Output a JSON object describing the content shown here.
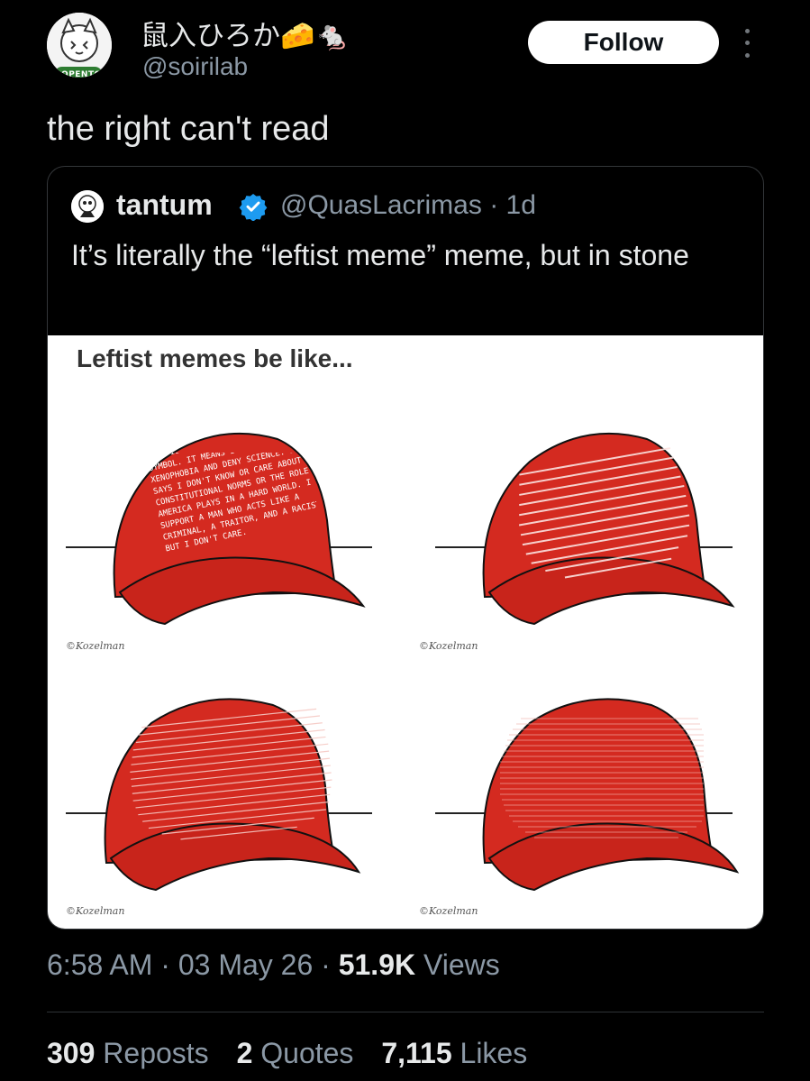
{
  "author": {
    "display_name": "鼠入ひろか🧀🐁",
    "handle": "@soirilab",
    "avatar_badge": "#OPENTOWORK"
  },
  "follow_label": "Follow",
  "tweet_text": "the right can't read",
  "quoted": {
    "name": "tantum",
    "handle_time": "@QuasLacrimas · 1d",
    "text": "It’s literally the “leftist meme” meme, but in stone",
    "meme": {
      "title": "Leftist memes be like...",
      "panel1_text": "THIS ISN'T JUST A HAT. IT'S A SYMBOL. IT MEANS I SUPPORT XENOPHOBIA AND DENY SCIENCE. IT SAYS I DON'T KNOW OR CARE ABOUT CONSTITUTIONAL NORMS OR THE ROLE AMERICA PLAYS IN A HARD WORLD. I SUPPORT A MAN WHO ACTS LIKE A CRIMINAL, A TRAITOR, AND A RACIST. BUT I DON'T CARE.",
      "signature": "©Kozelman"
    }
  },
  "meta": {
    "time": "6:58 AM",
    "date": "03 May 26",
    "views_count": "51.9K",
    "views_label": "Views"
  },
  "stats": {
    "reposts_count": "309",
    "reposts_label": "Reposts",
    "quotes_count": "2",
    "quotes_label": "Quotes",
    "likes_count": "7,115",
    "likes_label": "Likes"
  },
  "colors": {
    "background": "#000000",
    "text": "#e7e9ea",
    "muted": "#8b98a5",
    "verified": "#1d9bf0",
    "hat_red": "#d42a20"
  }
}
